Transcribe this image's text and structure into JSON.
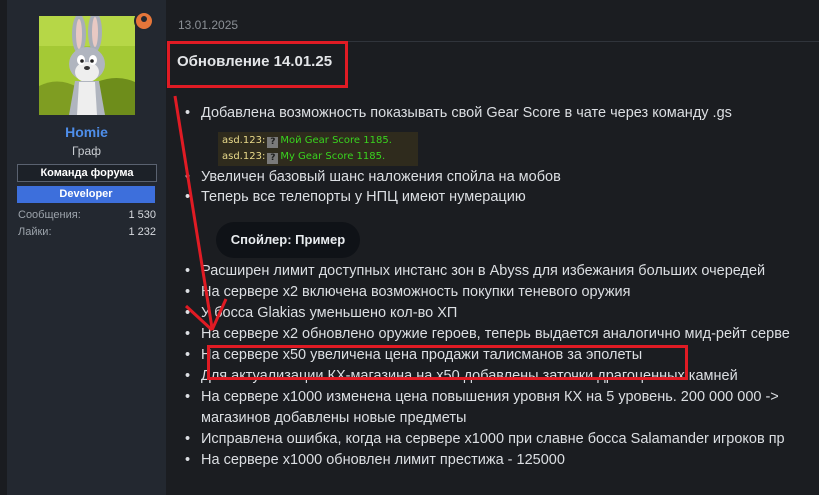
{
  "author": {
    "username": "Homie",
    "title": "Граф",
    "badges": [
      "Команда форума",
      "Developer"
    ],
    "stats": [
      {
        "label": "Сообщения:",
        "value": "1 530"
      },
      {
        "label": "Лайки:",
        "value": "1 232"
      }
    ]
  },
  "post": {
    "date": "13.01.2025",
    "title": "Обновление 14.01.25",
    "items": [
      "Добавлена возможность показывать свой Gear Score в чате через команду .gs",
      "Увеличен базовый шанс наложения спойла на мобов",
      "Теперь все телепорты у НПЦ имеют нумерацию",
      "Расширен лимит доступных инстанс зон в Abyss для избежания больших очередей",
      "На сервере x2 включена возможность покупки теневого оружия",
      "У босса Glakias уменьшено кол-во ХП",
      "На сервере x2 обновлено оружие героев, теперь выдается аналогично мид-рейт серве",
      "На сервере x50 увеличена цена продажи талисманов за эполеты",
      "Для актуализации КХ-магазина на x50 добавлены заточки драгоценных камней",
      "На сервере x1000 изменена цена повышения уровня КХ на 5 уровень. 200 000 000 ->",
      "магазинов добавлены новые предметы",
      "Исправлена ошибка, когда на сервере x1000 при славне босса Salamander игроков пр",
      "На сервере x1000 обновлен лимит престижа - 125000"
    ],
    "chat_sample": [
      {
        "name": "asd.123:",
        "message": "Мой Gear Score 1185."
      },
      {
        "name": "asd.123:",
        "message": "My Gear Score 1185."
      }
    ],
    "spoiler_label": "Спойлер: Пример"
  },
  "colors": {
    "highlight": "#e01b24",
    "username": "#4e8eea",
    "developer_badge": "#3d6fdc",
    "chat_text": "#39d31f"
  }
}
